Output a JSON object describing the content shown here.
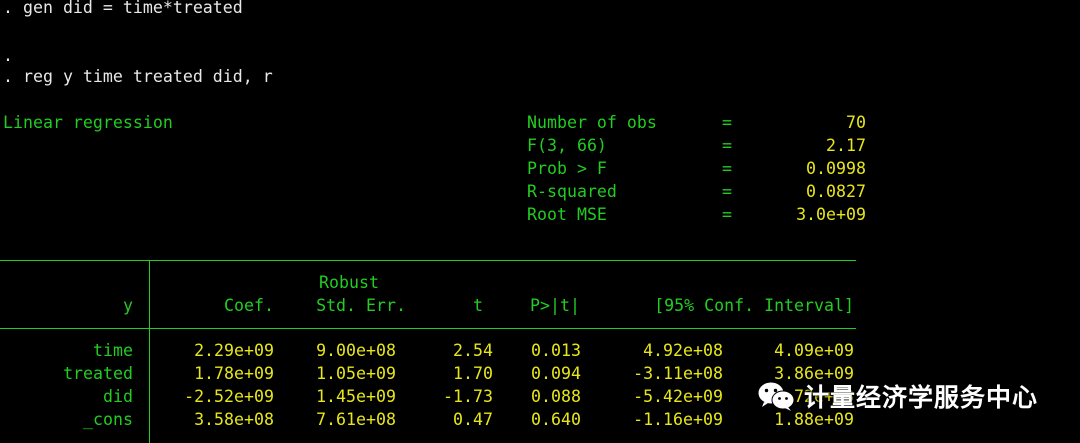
{
  "console": {
    "cmd1": ". gen did = time*treated",
    "dot": ".",
    "cmd2": ". reg y time treated did, r",
    "model_title": "Linear regression"
  },
  "stats": [
    {
      "label": "Number of obs",
      "eq": "=",
      "value": "70"
    },
    {
      "label": "F(3, 66)",
      "eq": "=",
      "value": "2.17"
    },
    {
      "label": "Prob > F",
      "eq": "=",
      "value": "0.0998"
    },
    {
      "label": "R-squared",
      "eq": "=",
      "value": "0.0827"
    },
    {
      "label": "Root MSE",
      "eq": "=",
      "value": "3.0e+09"
    }
  ],
  "table": {
    "robust_label": "Robust",
    "headers": {
      "depvar": "y",
      "coef": "Coef.",
      "se": "Std. Err.",
      "t": "t",
      "p": "P>|t|",
      "ci": "[95% Conf. Interval]"
    },
    "rows": [
      {
        "var": "time",
        "coef": "2.29e+09",
        "se": "9.00e+08",
        "t": "2.54",
        "p": "0.013",
        "lo": "4.92e+08",
        "hi": "4.09e+09"
      },
      {
        "var": "treated",
        "coef": "1.78e+09",
        "se": "1.05e+09",
        "t": "1.70",
        "p": "0.094",
        "lo": "-3.11e+08",
        "hi": "3.86e+09"
      },
      {
        "var": "did",
        "coef": "-2.52e+09",
        "se": "1.45e+09",
        "t": "-1.73",
        "p": "0.088",
        "lo": "-5.42e+09",
        "hi": "3.72e+08"
      },
      {
        "var": "_cons",
        "coef": "3.58e+08",
        "se": "7.61e+08",
        "t": "0.47",
        "p": "0.640",
        "lo": "-1.16e+09",
        "hi": "1.88e+09"
      }
    ]
  },
  "watermark": {
    "text": "计量经济学服务中心",
    "icon": "wechat-icon"
  }
}
